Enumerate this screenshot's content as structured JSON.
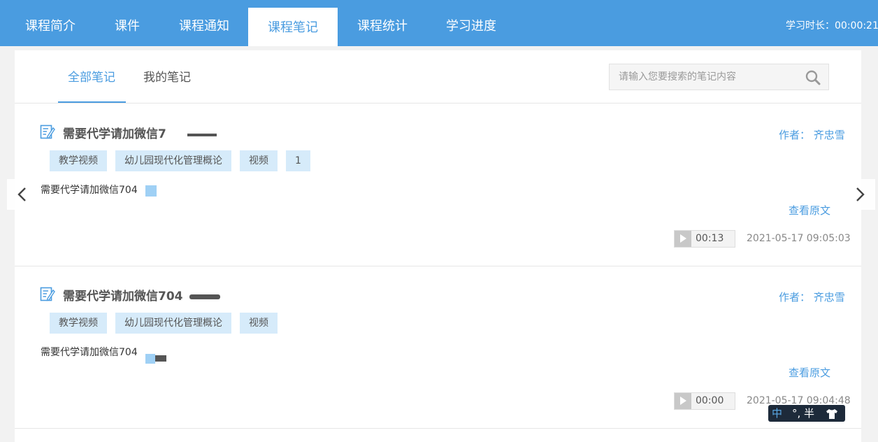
{
  "top_tabs": [
    {
      "label": "课程简介"
    },
    {
      "label": "课件"
    },
    {
      "label": "课程通知"
    },
    {
      "label": "课程笔记",
      "active": true
    },
    {
      "label": "课程统计"
    },
    {
      "label": "学习进度"
    }
  ],
  "study_time": "学习时长：00:00:21",
  "sub_tabs": [
    {
      "label": "全部笔记",
      "active": true
    },
    {
      "label": "我的笔记"
    }
  ],
  "search": {
    "placeholder": "请输入您要搜索的笔记内容",
    "value": ""
  },
  "notes": [
    {
      "title": "需要代学请加微信7",
      "author": "作者：  齐忠雪",
      "tags": [
        "教学视频",
        "幼儿园现代化管理概论",
        "视频",
        "1"
      ],
      "body": "需要代学请加微信704",
      "view_original": "查看原文",
      "play_time": "00:13",
      "date": "2021-05-17 09:05:03"
    },
    {
      "title": "需要代学请加微信704",
      "author": "作者：  齐忠雪",
      "tags": [
        "教学视频",
        "幼儿园现代化管理概论",
        "视频"
      ],
      "body": "需要代学请加微信704",
      "view_original": "查看原文",
      "play_time": "00:00",
      "date": "2021-05-17 09:04:48"
    }
  ],
  "ime": {
    "zh": "中",
    "rest": "°, 半"
  },
  "colors": {
    "accent": "#4a9ce0",
    "tag_bg": "#d6ebfa"
  }
}
